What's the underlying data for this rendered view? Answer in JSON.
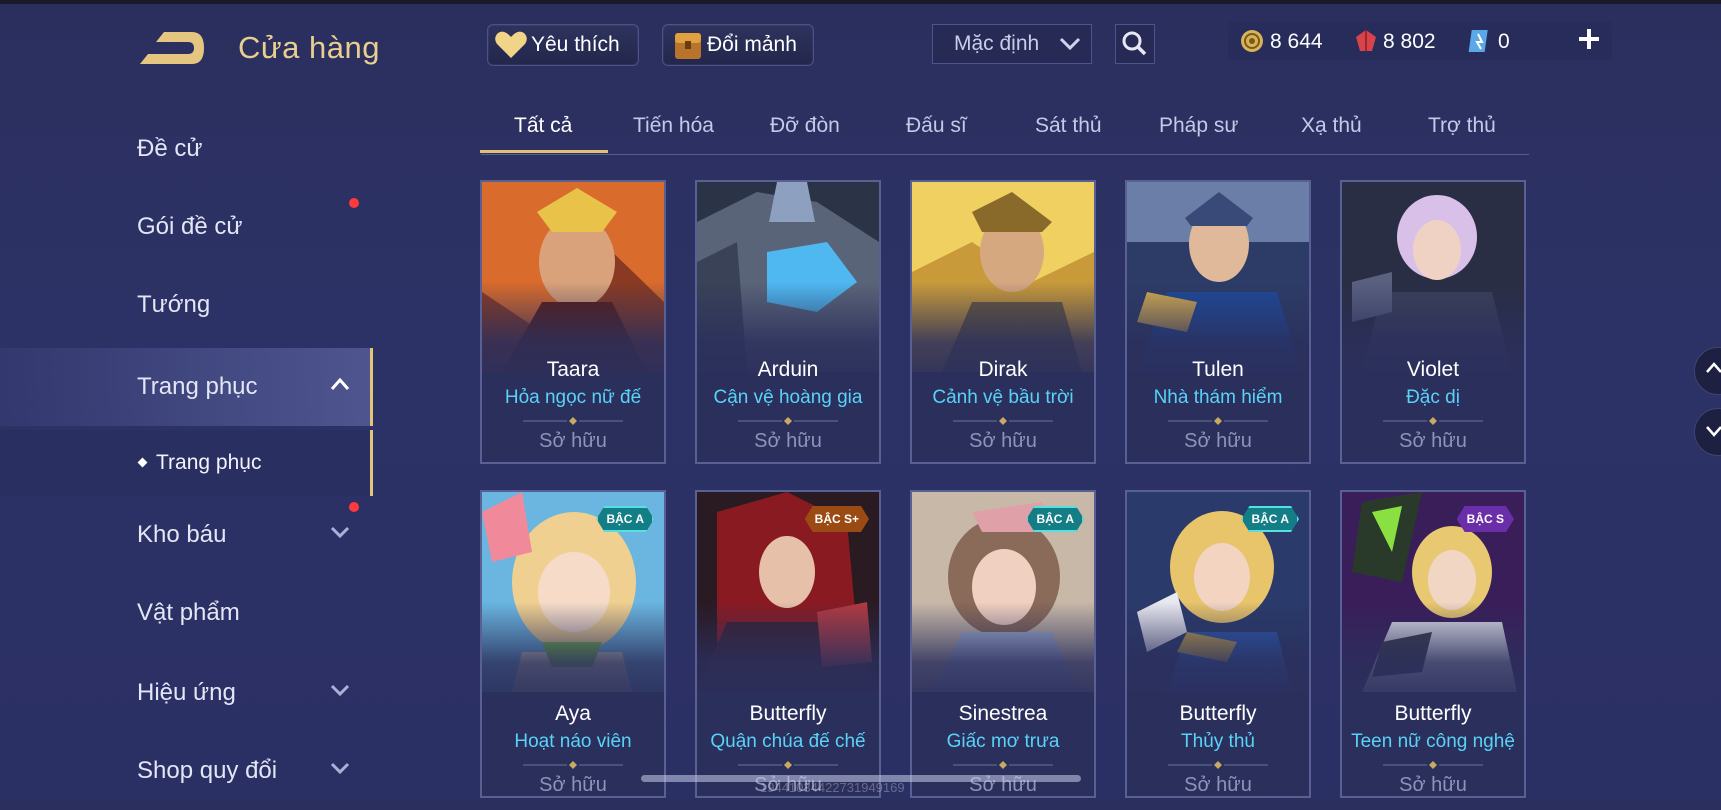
{
  "header": {
    "title": "Cửa hàng",
    "favorite_label": "Yêu thích",
    "exchange_label": "Đổi mảnh",
    "sort_value": "Mặc định"
  },
  "currency": {
    "gold": "8 644",
    "gems": "8 802",
    "vouchers": "0"
  },
  "sidebar": {
    "items": [
      {
        "label": "Đề cử"
      },
      {
        "label": "Gói đề cử"
      },
      {
        "label": "Tướng"
      },
      {
        "label": "Trang phục"
      },
      {
        "label": "Kho báu"
      },
      {
        "label": "Vật phẩm"
      },
      {
        "label": "Hiệu ứng"
      },
      {
        "label": "Shop quy đổi"
      }
    ],
    "sub_item": "Trang phục"
  },
  "tabs": [
    "Tất cả",
    "Tiến hóa",
    "Đỡ đòn",
    "Đấu sĩ",
    "Sát thủ",
    "Pháp sư",
    "Xạ thủ",
    "Trợ thủ"
  ],
  "cards": [
    {
      "hero": "Taara",
      "skin": "Hỏa ngọc nữ đế",
      "status": "Sở hữu",
      "badge": ""
    },
    {
      "hero": "Arduin",
      "skin": "Cận vệ hoàng gia",
      "status": "Sở hữu",
      "badge": ""
    },
    {
      "hero": "Dirak",
      "skin": "Cảnh vệ bầu trời",
      "status": "Sở hữu",
      "badge": ""
    },
    {
      "hero": "Tulen",
      "skin": "Nhà thám hiểm",
      "status": "Sở hữu",
      "badge": ""
    },
    {
      "hero": "Violet",
      "skin": "Đặc dị",
      "status": "Sở hữu",
      "badge": ""
    },
    {
      "hero": "Aya",
      "skin": "Hoạt náo viên",
      "status": "Sở hữu",
      "badge": "BẬC A"
    },
    {
      "hero": "Butterfly",
      "skin": "Quận chúa đế chế",
      "status": "Sở hữu",
      "badge": "BẬC S+"
    },
    {
      "hero": "Sinestrea",
      "skin": "Giấc mơ trưa",
      "status": "Sở hữu",
      "badge": "BẬC A"
    },
    {
      "hero": "Butterfly",
      "skin": "Thủy thủ",
      "status": "Sở hữu",
      "badge": "BẬC A"
    },
    {
      "hero": "Butterfly",
      "skin": "Teen nữ công nghệ",
      "status": "Sở hữu",
      "badge": "BẬC S"
    }
  ],
  "watermark": "19441034422731949169",
  "colors": {
    "accent_gold": "#e2c074",
    "skin_name": "#59d2f7",
    "background": "#2d3266",
    "notification": "#ff3a3a"
  }
}
